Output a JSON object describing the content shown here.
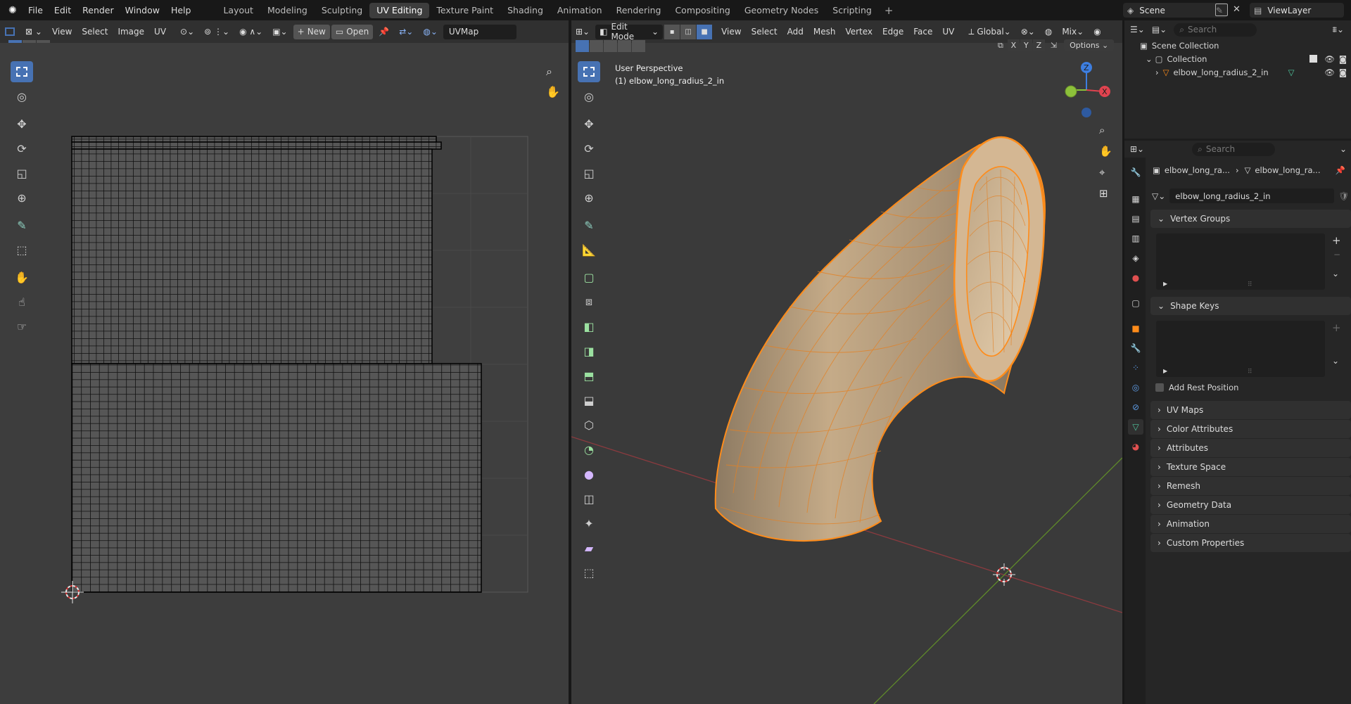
{
  "app": {
    "menus": [
      "File",
      "Edit",
      "Render",
      "Window",
      "Help"
    ],
    "workspaces": [
      {
        "label": "Layout"
      },
      {
        "label": "Modeling"
      },
      {
        "label": "Sculpting"
      },
      {
        "label": "UV Editing",
        "active": true
      },
      {
        "label": "Texture Paint"
      },
      {
        "label": "Shading"
      },
      {
        "label": "Animation"
      },
      {
        "label": "Rendering"
      },
      {
        "label": "Compositing"
      },
      {
        "label": "Geometry Nodes"
      },
      {
        "label": "Scripting"
      }
    ],
    "plus": "+",
    "scene": "Scene",
    "view_layer": "ViewLayer"
  },
  "uv_editor": {
    "menus": [
      "View",
      "Select",
      "Image",
      "UV"
    ],
    "new_label": "New",
    "open_label": "Open",
    "uvmap": "UVMap"
  },
  "viewport": {
    "mode": "Edit Mode",
    "menus": [
      "View",
      "Select",
      "Add",
      "Mesh",
      "Vertex",
      "Edge",
      "Face",
      "UV"
    ],
    "orientation": "Global",
    "proportional": "Mix",
    "axes": [
      "X",
      "Y",
      "Z"
    ],
    "options": "Options",
    "overlay_line1": "User Perspective",
    "overlay_line2": "(1) elbow_long_radius_2_in",
    "gizmo": {
      "z": "Z",
      "x": "X"
    }
  },
  "outliner": {
    "search_placeholder": "Search",
    "scene_collection": "Scene Collection",
    "collection": "Collection",
    "object": "elbow_long_radius_2_in"
  },
  "properties": {
    "search_placeholder": "Search",
    "breadcrumb1": "elbow_long_ra...",
    "breadcrumb2": "elbow_long_ra...",
    "mesh_name": "elbow_long_radius_2_in",
    "vertex_groups": "Vertex Groups",
    "shape_keys": "Shape Keys",
    "add_rest_position": "Add Rest Position",
    "panels": [
      "UV Maps",
      "Color Attributes",
      "Attributes",
      "Texture Space",
      "Remesh",
      "Geometry Data",
      "Animation",
      "Custom Properties"
    ]
  },
  "colors": {
    "accent": "#4772b3",
    "mesh_orange": "#ff8c1a",
    "x_axis": "#e0434f",
    "y_axis": "#8cc13a",
    "z_axis": "#3d7ee0"
  }
}
